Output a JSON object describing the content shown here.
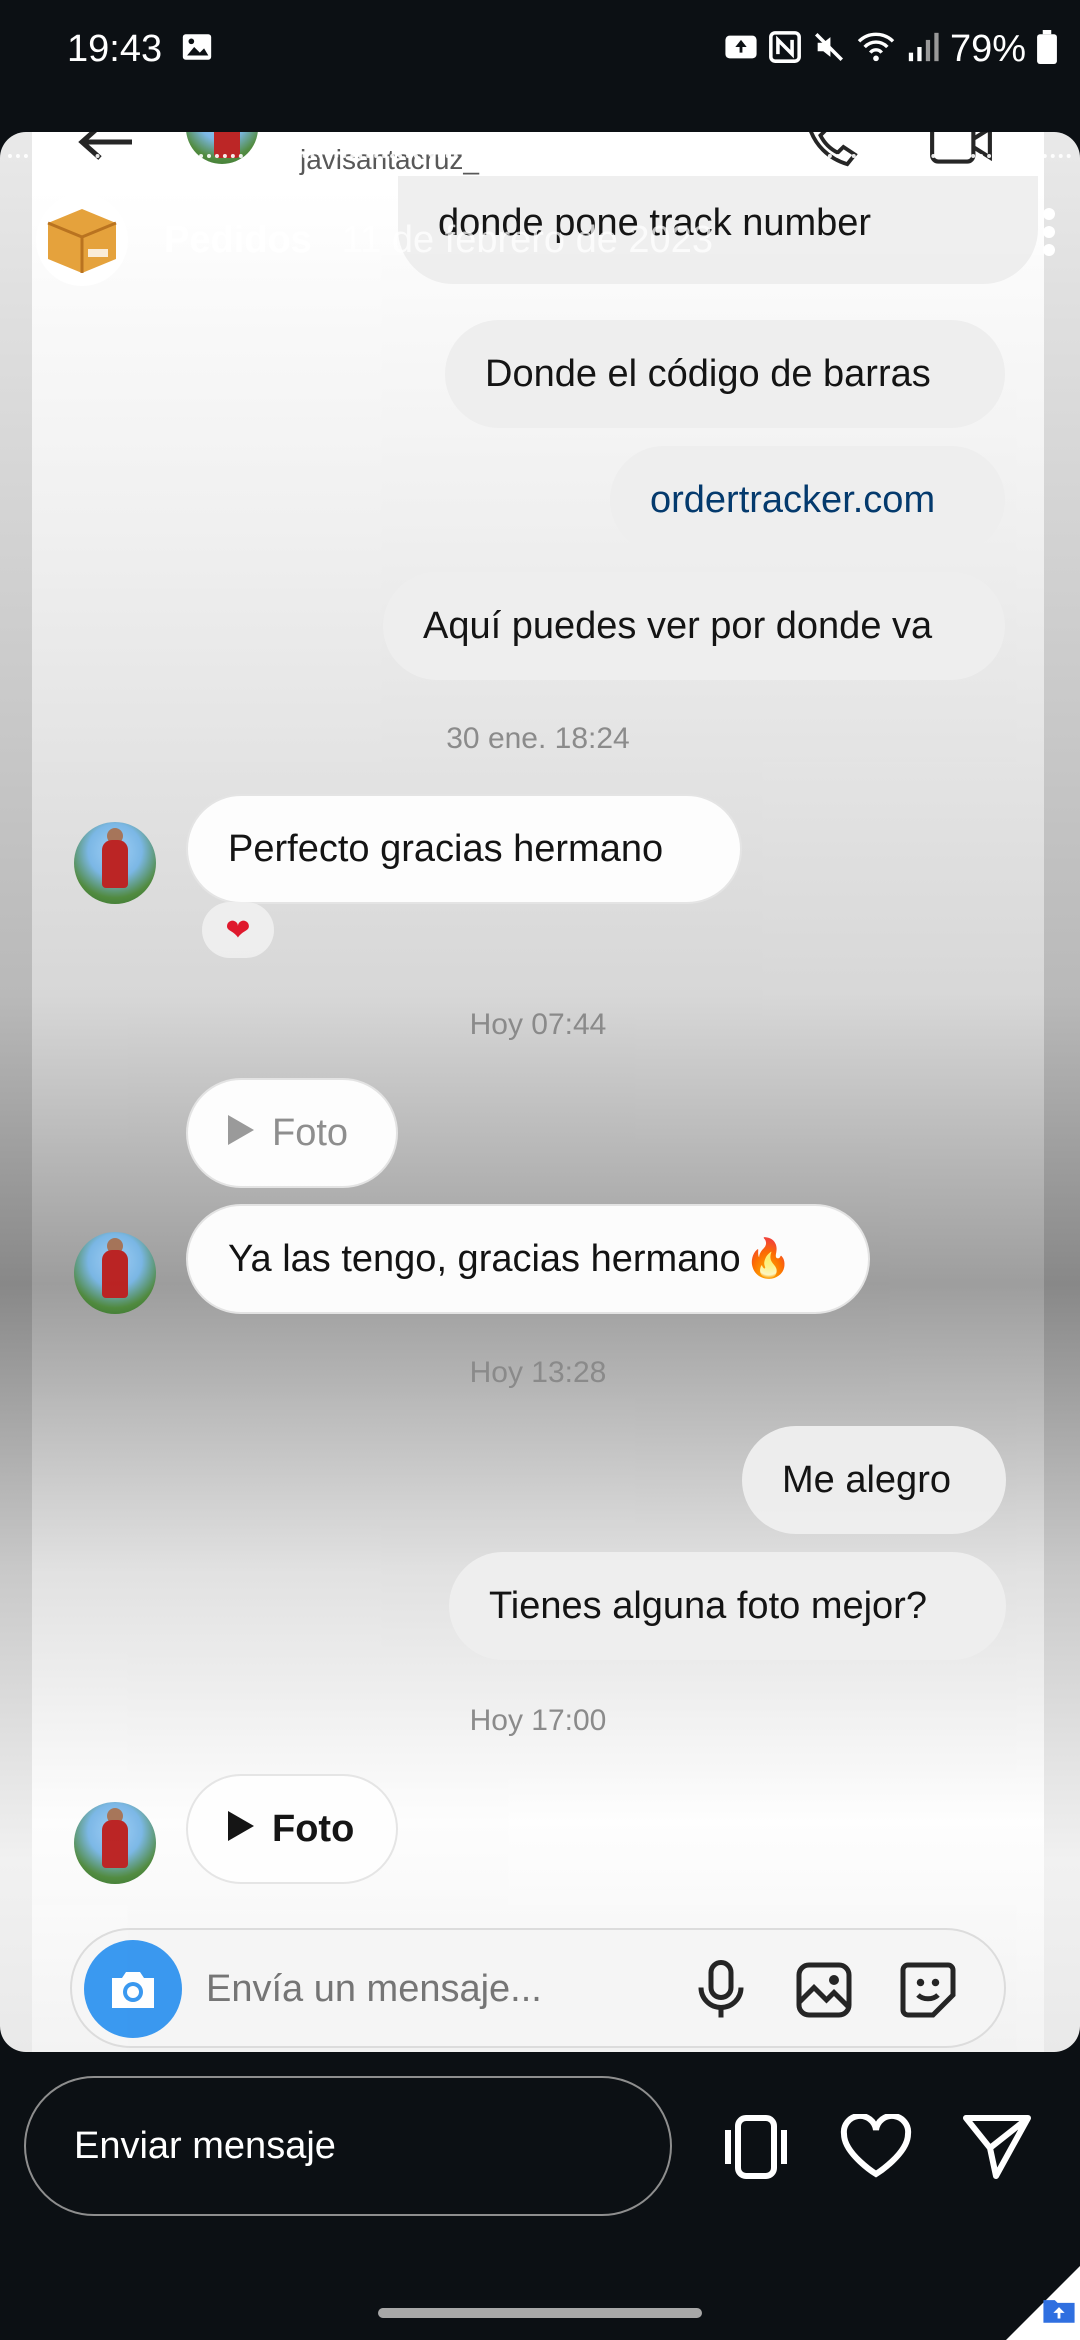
{
  "status_bar": {
    "time": "19:43",
    "battery": "79%"
  },
  "inner_header": {
    "username": "javisantacruz_"
  },
  "story_overlay": {
    "title": "Pedidos",
    "date": "11 de febrero de 2023"
  },
  "messages": [
    {
      "text": "El código de seguimiento es donde pone track number",
      "visible_text": "donde pone track number"
    },
    {
      "text": "Donde el código de barras"
    },
    {
      "text": "ordertracker.com"
    },
    {
      "text": "Aquí puedes ver por donde va"
    },
    {
      "timestamp": "30 ene. 18:24"
    },
    {
      "text": "Perfecto gracias hermano",
      "reaction": "❤"
    },
    {
      "timestamp": "Hoy 07:44"
    },
    {
      "text": "Foto"
    },
    {
      "text": "Ya las tengo, gracias hermano",
      "emoji": "🔥"
    },
    {
      "timestamp": "Hoy 13:28"
    },
    {
      "text": "Me alegro"
    },
    {
      "text": "Tienes alguna foto mejor?"
    },
    {
      "timestamp": "Hoy 17:00"
    },
    {
      "text": "Foto"
    }
  ],
  "composer": {
    "placeholder": "Envía un mensaje..."
  },
  "story_footer": {
    "reply_placeholder": "Enviar mensaje"
  },
  "colors": {
    "accent": "#3797f0",
    "link": "#00376b",
    "heart": "#e0162b"
  }
}
